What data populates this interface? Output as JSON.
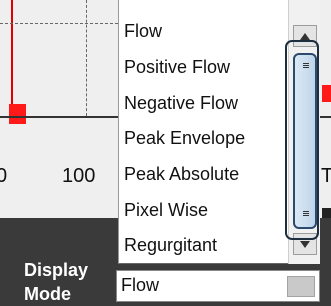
{
  "plot": {
    "tick_labels": [
      "0",
      "100"
    ],
    "right_partial_text": "T"
  },
  "display_mode": {
    "label": "Display Mode",
    "selected_value": "Flow",
    "options": [
      "Flow",
      "Positive Flow",
      "Negative Flow",
      "Peak Envelope",
      "Peak Absolute",
      "Pixel Wise",
      "Regurgitant"
    ]
  },
  "colors": {
    "plot_background": "#efefef",
    "marker_red": "#ff1a1a",
    "panel_dark": "#3a3a3a",
    "scroll_thumb": "#bfd4ea"
  },
  "icons": {
    "scroll_up": "arrow-up-icon",
    "scroll_down": "arrow-down-icon",
    "thumb_grip": "grip-icon",
    "combo_button": "dropdown-button"
  }
}
